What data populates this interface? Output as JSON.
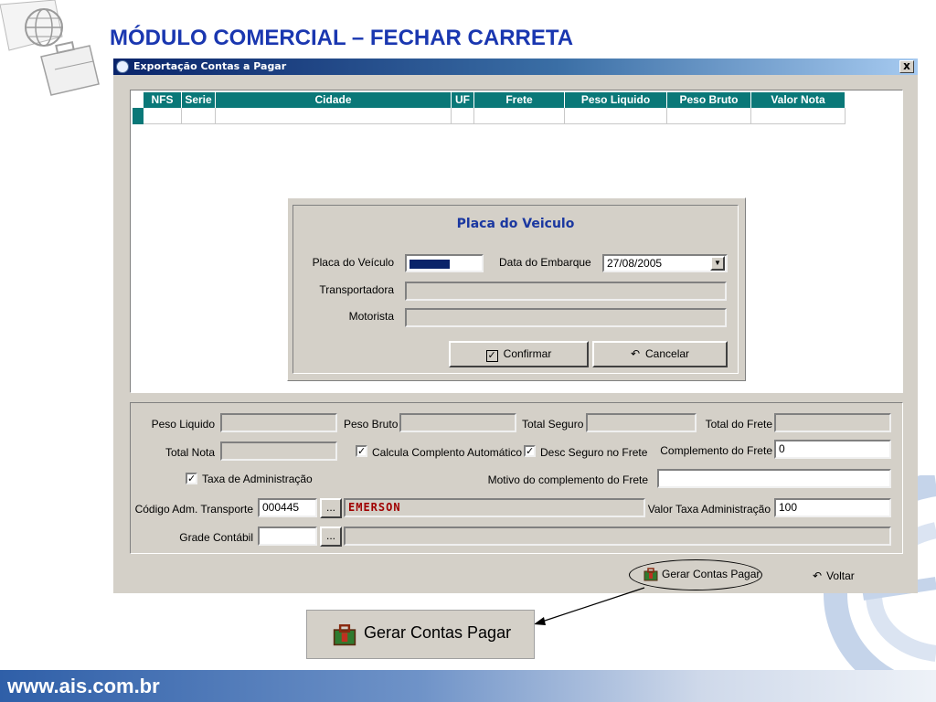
{
  "slide": {
    "title": "MÓDULO COMERCIAL – FECHAR CARRETA",
    "footer_url": "www.ais.com.br"
  },
  "window": {
    "title": "Exportação Contas a Pagar",
    "close_label": "x"
  },
  "grid": {
    "columns": [
      "NFS",
      "Serie",
      "Cidade",
      "UF",
      "Frete",
      "Peso Liquido",
      "Peso Bruto",
      "Valor Nota"
    ]
  },
  "dialog": {
    "title": "Placa do Veiculo",
    "placa_label": "Placa do Veículo",
    "placa_value": "",
    "data_label": "Data do Embarque",
    "data_value": "27/08/2005",
    "transportadora_label": "Transportadora",
    "transportadora_value": "",
    "motorista_label": "Motorista",
    "motorista_value": "",
    "confirm_label": "Confirmar",
    "cancel_label": "Cancelar"
  },
  "form": {
    "peso_liquido_label": "Peso Liquido",
    "peso_liquido_value": "",
    "peso_bruto_label": "Peso Bruto",
    "peso_bruto_value": "",
    "total_seguro_label": "Total Seguro",
    "total_seguro_value": "",
    "total_frete_label": "Total do Frete",
    "total_frete_value": "",
    "total_nota_label": "Total Nota",
    "total_nota_value": "",
    "calcula_label": "Calcula Complento Automático",
    "calcula_checked": true,
    "desc_seguro_label": "Desc Seguro no Frete",
    "desc_seguro_checked": true,
    "complemento_label": "Complemento do Frete",
    "complemento_value": "0",
    "taxa_label": "Taxa de Administração",
    "taxa_checked": true,
    "motivo_label": "Motivo do complemento do Frete",
    "motivo_value": "",
    "codigo_label": "Código Adm. Transporte",
    "codigo_value": "000445",
    "codigo_name": "EMERSON",
    "valor_taxa_label": "Valor Taxa Administração",
    "valor_taxa_value": "100",
    "grade_label": "Grade Contábil",
    "grade_value": "",
    "grade_desc": "",
    "ellipsis_label": "..."
  },
  "actions": {
    "gerar_label": "Gerar Contas Pagar",
    "voltar_label": "Voltar"
  },
  "callout": {
    "label": "Gerar Contas Pagar"
  },
  "colors": {
    "title_blue": "#1a37b0",
    "grid_header": "#0a7878",
    "codigo_name_red": "#a00000"
  }
}
